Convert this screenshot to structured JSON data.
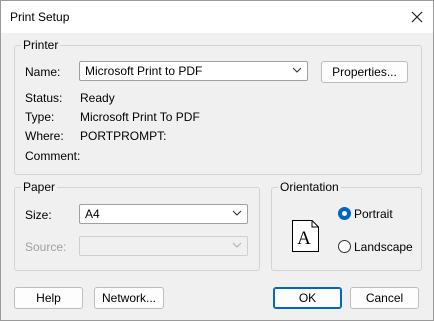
{
  "window": {
    "title": "Print Setup"
  },
  "printer": {
    "group_label": "Printer",
    "name_label": "Name:",
    "name_value": "Microsoft Print to PDF",
    "properties_label": "Properties...",
    "status_label": "Status:",
    "status_value": "Ready",
    "type_label": "Type:",
    "type_value": "Microsoft Print To PDF",
    "where_label": "Where:",
    "where_value": "PORTPROMPT:",
    "comment_label": "Comment:",
    "comment_value": ""
  },
  "paper": {
    "group_label": "Paper",
    "size_label": "Size:",
    "size_value": "A4",
    "source_label": "Source:",
    "source_value": ""
  },
  "orientation": {
    "group_label": "Orientation",
    "preview_letter": "A",
    "portrait_label": "Portrait",
    "landscape_label": "Landscape",
    "selected": "Portrait"
  },
  "buttons": {
    "help": "Help",
    "network": "Network...",
    "ok": "OK",
    "cancel": "Cancel"
  },
  "colors": {
    "accent": "#0067c0"
  }
}
